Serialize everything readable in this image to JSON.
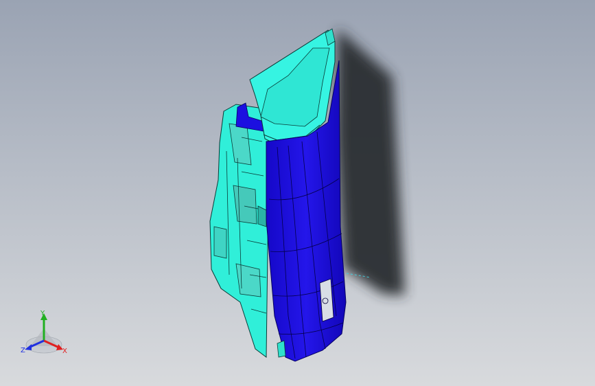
{
  "viewport": {
    "background_top": "#9aa3b3",
    "background_bottom": "#d8dadd"
  },
  "model": {
    "primary_color": "#1c10e0",
    "secondary_color": "#2ef0dc",
    "shadow_color": "#2c2e33"
  },
  "triad": {
    "x_label": "X",
    "y_label": "Y",
    "z_label": "Z",
    "x_color": "#e02020",
    "y_color": "#20b020",
    "z_color": "#2030e0"
  }
}
